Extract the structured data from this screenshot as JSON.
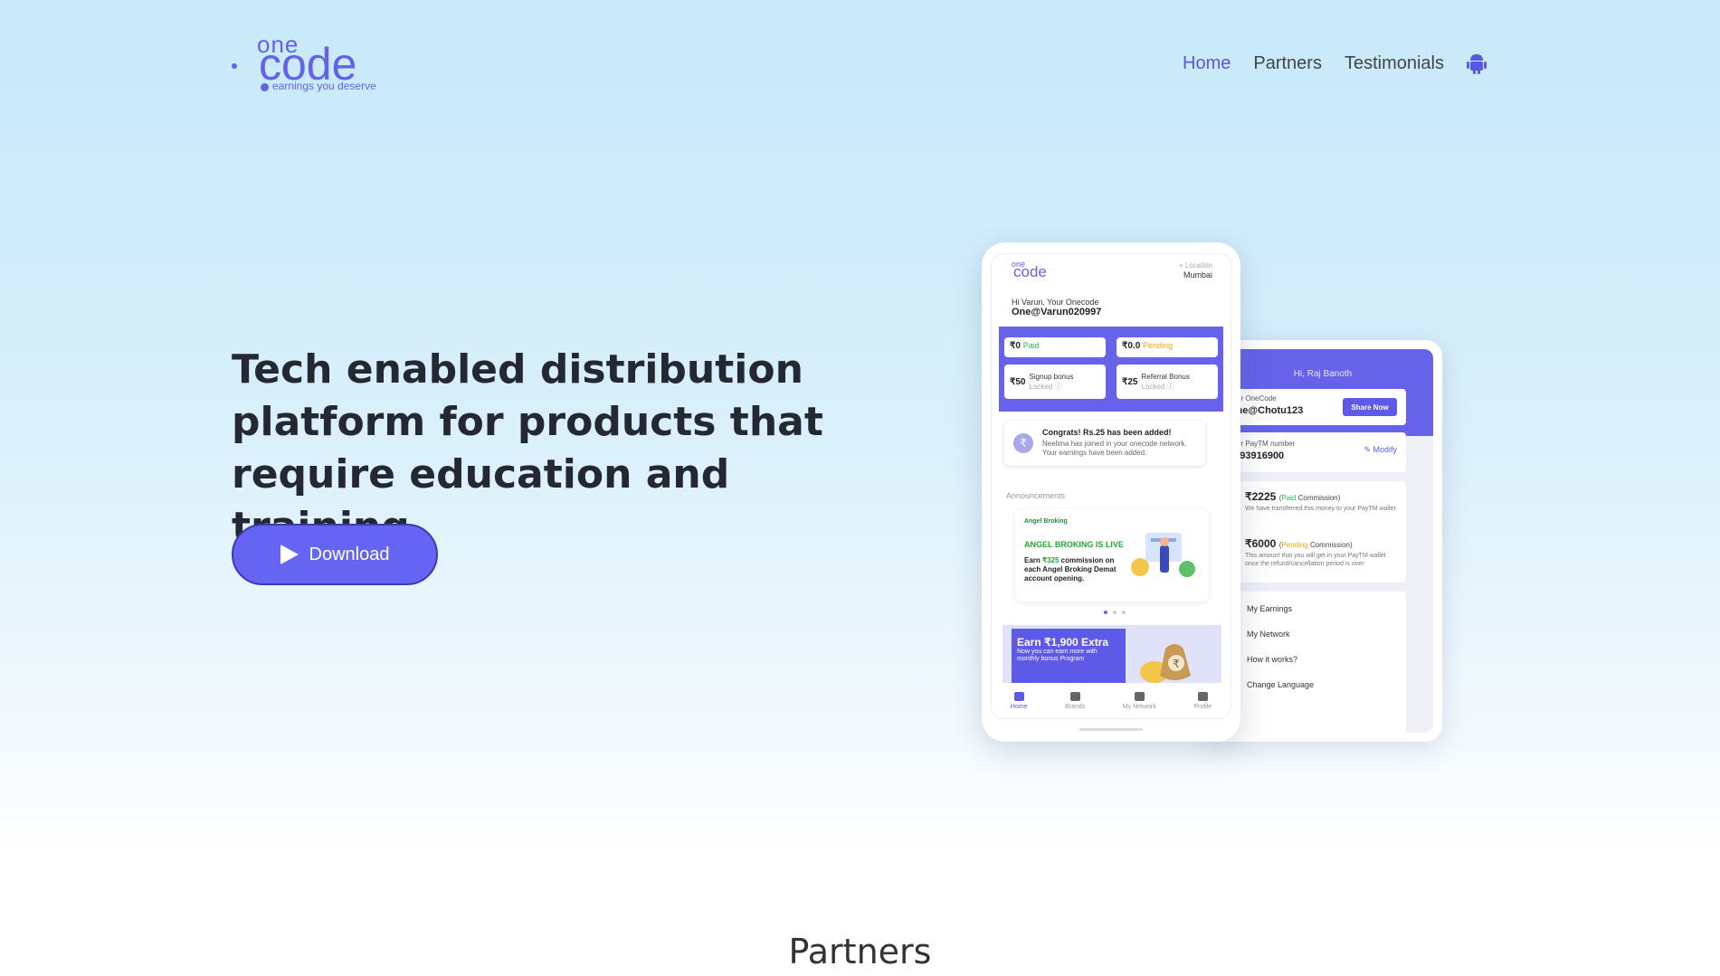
{
  "brand": {
    "logo_one": "one",
    "logo_code": "code",
    "tagline": "earnings you deserve",
    "accent_color": "#6462e6"
  },
  "nav": {
    "items": [
      {
        "label": "Home",
        "active": true
      },
      {
        "label": "Partners",
        "active": false
      },
      {
        "label": "Testimonials",
        "active": false
      }
    ],
    "android_icon": "android-icon"
  },
  "hero": {
    "title_line1": "Tech enabled distribution",
    "title_line2": "platform for products that",
    "title_line3": "require education and training",
    "download_label": "Download",
    "button_color": "#6664f2"
  },
  "phone_main": {
    "logo_one": "one",
    "logo_code": "code",
    "location_label": "Location",
    "location_value": "Mumbai",
    "greeting": "Hi Varun, Your Onecode",
    "onecode": "One@Varun020997",
    "paid_amount": "₹0",
    "paid_label": "Paid",
    "pending_amount": "₹0.0",
    "pending_label": "Pending",
    "signup_amount": "₹50",
    "signup_label": "Signup bonus",
    "signup_status": "Locked",
    "referral_amount": "₹25",
    "referral_label": "Referral Bonus",
    "referral_status": "Locked",
    "congrats_title": "Congrats! Rs.25 has been added!",
    "congrats_text": "Neelima has joined in your onecode network. Your earnings have been added.",
    "announcements_label": "Announcements",
    "banner_brand": "Angel Broking",
    "banner_live": "ANGEL BROKING IS LIVE",
    "banner_earn_pre": "Earn ",
    "banner_earn_amt": "₹325",
    "banner_earn_post": " commission on each Angel Broking Demat account opening.",
    "promo_title": "Earn ₹1,900 Extra",
    "promo_text": "Now you can earn more with monthly bonus Program",
    "tabs": [
      "Home",
      "Brands",
      "My Network",
      "Profile"
    ]
  },
  "phone_back": {
    "greeting": "Hi, Raj Banoth",
    "code_label": "Your OneCode",
    "code_value": "One@Chotu123",
    "share_label": "Share Now",
    "paytm_label": "Your PayTM number",
    "paytm_value": "7793916900",
    "modify_label": "Modify",
    "paid_amount": "₹2225",
    "paid_word": "Paid",
    "commission_word": "Commission",
    "paid_desc": "We have transferred this money to your PayTM wallet",
    "pending_amount": "₹6000",
    "pending_word": "Pending",
    "pending_desc": "This amount that you will get in your PayTM wallet once the refund/cancellation period is over",
    "menu": [
      "My Earnings",
      "My Network",
      "How it works?",
      "Change Language"
    ]
  },
  "sections": {
    "partners_heading": "Partners"
  }
}
